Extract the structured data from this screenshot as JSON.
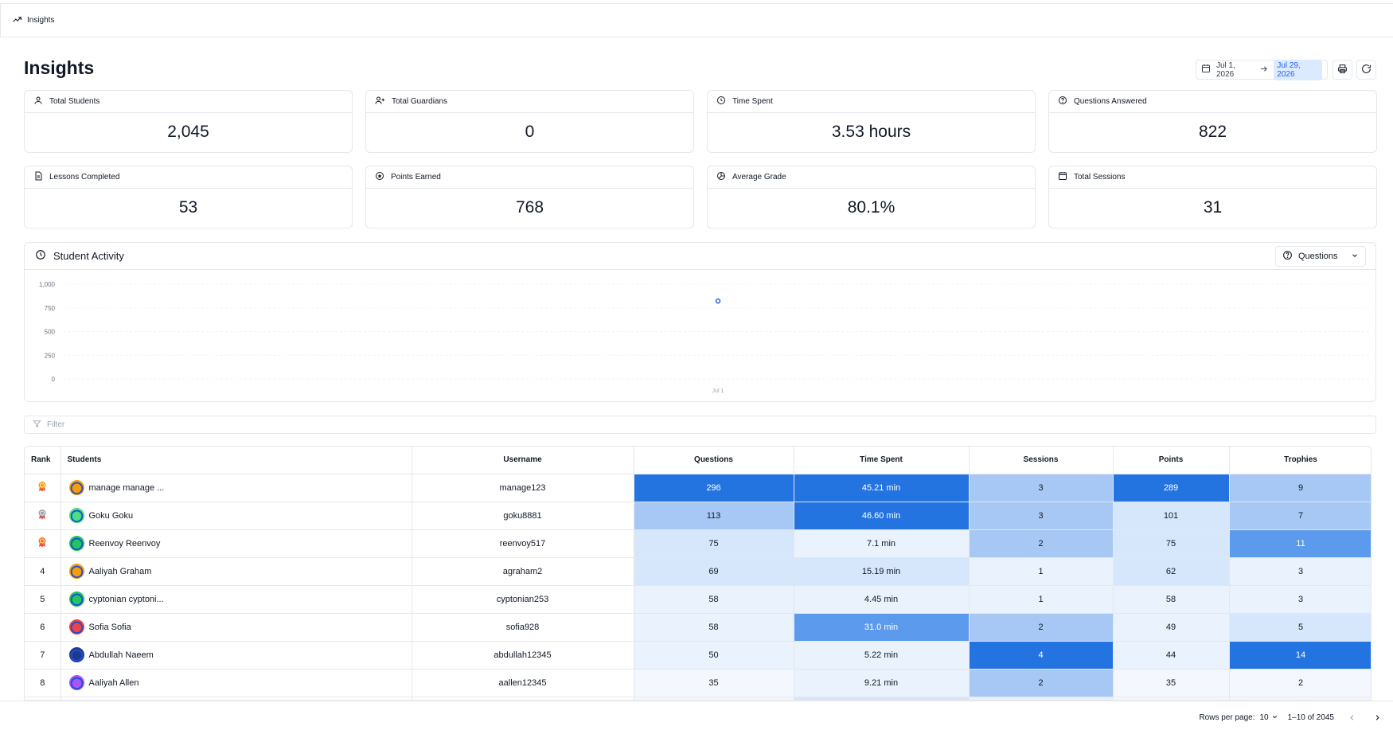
{
  "breadcrumb": {
    "label": "Insights"
  },
  "header": {
    "title": "Insights",
    "date_start": "Jul 1, 2026",
    "date_end": "Jul 29, 2026"
  },
  "stats": [
    {
      "label": "Total Students",
      "value": "2,045",
      "icon": "user-icon"
    },
    {
      "label": "Total Guardians",
      "value": "0",
      "icon": "users-icon"
    },
    {
      "label": "Time Spent",
      "value": "3.53 hours",
      "icon": "clock-icon"
    },
    {
      "label": "Questions Answered",
      "value": "822",
      "icon": "help-circle-icon"
    },
    {
      "label": "Lessons Completed",
      "value": "53",
      "icon": "document-icon"
    },
    {
      "label": "Points Earned",
      "value": "768",
      "icon": "star-circle-icon"
    },
    {
      "label": "Average Grade",
      "value": "80.1%",
      "icon": "pie-chart-icon"
    },
    {
      "label": "Total Sessions",
      "value": "31",
      "icon": "calendar-icon"
    }
  ],
  "activity": {
    "title": "Student Activity",
    "metric_label": "Questions"
  },
  "chart_data": {
    "type": "line",
    "x": [
      "Jul 1"
    ],
    "series": [
      {
        "values": [
          822
        ]
      }
    ],
    "yticks": [
      "0",
      "250",
      "500",
      "750",
      "1,000"
    ],
    "ylim": [
      0,
      1000
    ],
    "grid": true
  },
  "filter": {
    "placeholder": "Filter"
  },
  "table": {
    "headers": [
      "Rank",
      "Students",
      "Username",
      "Questions",
      "Time Spent",
      "Sessions",
      "Points",
      "Trophies"
    ],
    "rows": [
      {
        "rank": "",
        "medal": "gold",
        "name": "manage manage ...",
        "username": "manage123",
        "questions": "296",
        "time": "45.21 min",
        "sessions": "3",
        "points": "289",
        "trophies": "9",
        "avatar": "#f59e0b",
        "shade": [
          5,
          5,
          3,
          5,
          3
        ]
      },
      {
        "rank": "",
        "medal": "silver",
        "name": "Goku Goku",
        "username": "goku8881",
        "questions": "113",
        "time": "46.60 min",
        "sessions": "3",
        "points": "101",
        "trophies": "7",
        "avatar": "#4ade80",
        "shade": [
          3,
          5,
          3,
          2,
          3
        ]
      },
      {
        "rank": "",
        "medal": "bronze",
        "name": "Reenvoy Reenvoy",
        "username": "reenvoy517",
        "questions": "75",
        "time": "7.1 min",
        "sessions": "2",
        "points": "75",
        "trophies": "11",
        "avatar": "#22c55e",
        "shade": [
          2,
          1,
          3,
          2,
          4
        ]
      },
      {
        "rank": "4",
        "medal": "",
        "name": "Aaliyah Graham",
        "username": "agraham2",
        "questions": "69",
        "time": "15.19 min",
        "sessions": "1",
        "points": "62",
        "trophies": "3",
        "avatar": "#f59e0b",
        "shade": [
          2,
          2,
          1,
          2,
          1
        ]
      },
      {
        "rank": "5",
        "medal": "",
        "name": "cyptonian cyptoni...",
        "username": "cyptonian253",
        "questions": "58",
        "time": "4.45 min",
        "sessions": "1",
        "points": "58",
        "trophies": "3",
        "avatar": "#22c55e",
        "shade": [
          1,
          1,
          1,
          1,
          1
        ]
      },
      {
        "rank": "6",
        "medal": "",
        "name": "Sofia Sofia",
        "username": "sofia928",
        "questions": "58",
        "time": "31.0 min",
        "sessions": "2",
        "points": "49",
        "trophies": "5",
        "avatar": "#ef4444",
        "shade": [
          1,
          4,
          3,
          1,
          2
        ]
      },
      {
        "rank": "7",
        "medal": "",
        "name": "Abdullah Naeem",
        "username": "abdullah12345",
        "questions": "50",
        "time": "5.22 min",
        "sessions": "4",
        "points": "44",
        "trophies": "14",
        "avatar": "#1e3a8a",
        "shade": [
          1,
          1,
          5,
          1,
          5
        ]
      },
      {
        "rank": "8",
        "medal": "",
        "name": "Aaliyah Allen",
        "username": "aallen12345",
        "questions": "35",
        "time": "9.21 min",
        "sessions": "2",
        "points": "35",
        "trophies": "2",
        "avatar": "#a855f7",
        "shade": [
          0,
          1,
          3,
          0,
          0
        ]
      },
      {
        "rank": "",
        "medal": "",
        "name": "",
        "username": "",
        "questions": "",
        "time": "",
        "sessions": "",
        "points": "",
        "trophies": "",
        "avatar": "#ffffff",
        "shade": [
          0,
          2,
          1,
          0,
          0
        ]
      }
    ]
  },
  "footer": {
    "rows_per_page_label": "Rows per page:",
    "rows_per_page": "10",
    "range": "1–10 of 2045"
  },
  "colors": {
    "shade_0": "#f4f8fe",
    "shade_1": "#eaf2fd",
    "shade_2": "#d6e6fb",
    "shade_3": "#a7c8f4",
    "shade_4": "#5b9aec",
    "shade_5": "#2374e1",
    "accent": "#2563eb"
  }
}
